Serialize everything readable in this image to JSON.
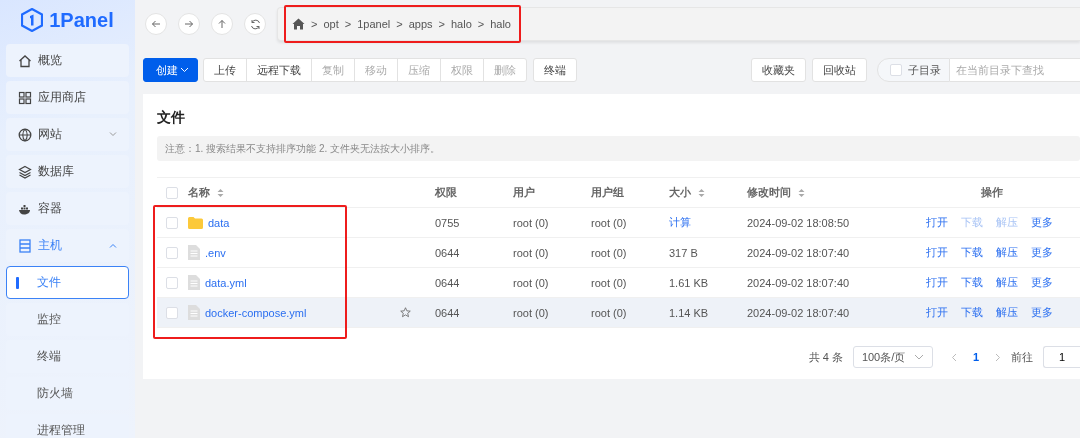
{
  "logo": {
    "text": "1Panel"
  },
  "sidebar": {
    "items": [
      {
        "label": "概览",
        "expanded": false,
        "has_caret": false
      },
      {
        "label": "应用商店",
        "expanded": false,
        "has_caret": false
      },
      {
        "label": "网站",
        "expanded": false,
        "has_caret": true
      },
      {
        "label": "数据库",
        "expanded": false,
        "has_caret": false
      },
      {
        "label": "容器",
        "expanded": false,
        "has_caret": false
      },
      {
        "label": "主机",
        "expanded": true,
        "has_caret": true,
        "children": [
          {
            "label": "文件",
            "selected": true
          },
          {
            "label": "监控",
            "selected": false
          },
          {
            "label": "终端",
            "selected": false
          },
          {
            "label": "防火墙",
            "selected": false
          },
          {
            "label": "进程管理",
            "selected": false
          }
        ]
      }
    ]
  },
  "breadcrumb": {
    "highlighted": true,
    "parts": [
      {
        "separator": ">",
        "label": "opt"
      },
      {
        "separator": ">",
        "label": "1panel"
      },
      {
        "separator": ">",
        "label": "apps"
      },
      {
        "separator": ">",
        "label": "halo"
      },
      {
        "separator": ">",
        "label": "halo"
      }
    ]
  },
  "toolbar": {
    "create": "创建",
    "buttons": [
      {
        "label": "上传",
        "disabled": false
      },
      {
        "label": "远程下载",
        "disabled": false
      },
      {
        "label": "复制",
        "disabled": true
      },
      {
        "label": "移动",
        "disabled": true
      },
      {
        "label": "压缩",
        "disabled": true
      },
      {
        "label": "权限",
        "disabled": true
      },
      {
        "label": "删除",
        "disabled": true
      }
    ],
    "terminal": "终端",
    "favorites": "收藏夹",
    "recycle": "回收站",
    "subdir": {
      "label": "子目录",
      "checked": false
    },
    "search": {
      "placeholder": "在当前目录下查找"
    }
  },
  "card": {
    "title": "文件",
    "notice": "注意：1. 搜索结果不支持排序功能 2. 文件夹无法按大小排序。"
  },
  "table": {
    "names_highlighted": true,
    "select_all_checked": false,
    "columns": [
      {
        "label": "名称",
        "sortable": true
      },
      {
        "label": "权限",
        "sortable": false
      },
      {
        "label": "用户",
        "sortable": false
      },
      {
        "label": "用户组",
        "sortable": false
      },
      {
        "label": "大小",
        "sortable": true
      },
      {
        "label": "修改时间",
        "sortable": true
      },
      {
        "label": "操作",
        "sortable": false
      }
    ],
    "rows": [
      {
        "kind": "folder",
        "name": "data",
        "favorite_shown": false,
        "hovered": false,
        "checked": false,
        "permission": "0755",
        "user": "root (0)",
        "group": "root (0)",
        "size": "计算",
        "size_is_link": true,
        "modified": "2024-09-02 18:08:50",
        "actions": [
          {
            "label": "打开",
            "disabled": false
          },
          {
            "label": "下载",
            "disabled": true
          },
          {
            "label": "解压",
            "disabled": true
          },
          {
            "label": "更多",
            "disabled": false
          }
        ]
      },
      {
        "kind": "file",
        "name": ".env",
        "favorite_shown": false,
        "hovered": false,
        "checked": false,
        "permission": "0644",
        "user": "root (0)",
        "group": "root (0)",
        "size": "317 B",
        "size_is_link": false,
        "modified": "2024-09-02 18:07:40",
        "actions": [
          {
            "label": "打开",
            "disabled": false
          },
          {
            "label": "下载",
            "disabled": false
          },
          {
            "label": "解压",
            "disabled": false
          },
          {
            "label": "更多",
            "disabled": false
          }
        ]
      },
      {
        "kind": "file",
        "name": "data.yml",
        "favorite_shown": false,
        "hovered": false,
        "checked": false,
        "permission": "0644",
        "user": "root (0)",
        "group": "root (0)",
        "size": "1.61 KB",
        "size_is_link": false,
        "modified": "2024-09-02 18:07:40",
        "actions": [
          {
            "label": "打开",
            "disabled": false
          },
          {
            "label": "下载",
            "disabled": false
          },
          {
            "label": "解压",
            "disabled": false
          },
          {
            "label": "更多",
            "disabled": false
          }
        ]
      },
      {
        "kind": "file",
        "name": "docker-compose.yml",
        "favorite_shown": true,
        "hovered": true,
        "checked": false,
        "permission": "0644",
        "user": "root (0)",
        "group": "root (0)",
        "size": "1.14 KB",
        "size_is_link": false,
        "modified": "2024-09-02 18:07:40",
        "actions": [
          {
            "label": "打开",
            "disabled": false
          },
          {
            "label": "下载",
            "disabled": false
          },
          {
            "label": "解压",
            "disabled": false
          },
          {
            "label": "更多",
            "disabled": false
          }
        ]
      }
    ]
  },
  "pagination": {
    "total": "共 4 条",
    "page_size": "100条/页",
    "pages": [
      {
        "label": "1",
        "selected": true
      }
    ],
    "goto_label": "前往",
    "goto_value": "1"
  }
}
